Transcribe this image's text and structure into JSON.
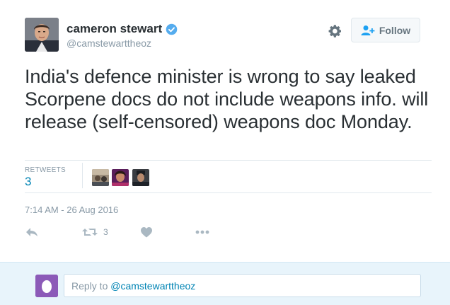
{
  "author": {
    "name": "cameron stewart",
    "handle": "@camstewarttheoz",
    "verified": true
  },
  "follow_button": {
    "label": "Follow"
  },
  "tweet": {
    "text": "India's defence minister is wrong to say leaked Scorpene docs do not include weapons info. will release (self-censored) weapons doc Monday.",
    "timestamp": "7:14 AM - 26 Aug 2016"
  },
  "stats": {
    "retweets_label": "RETWEETS",
    "retweets_count": "3"
  },
  "actions": {
    "reply_icon": "reply-arrow-icon",
    "retweet_icon": "retweet-icon",
    "retweet_count": "3",
    "like_icon": "heart-icon",
    "more_icon": "more-dots-icon"
  },
  "reply_box": {
    "prefix": "Reply to ",
    "mention": "@camstewarttheoz"
  },
  "colors": {
    "link_blue": "#0084b4",
    "verified_blue": "#55acee",
    "muted_gray": "#8899a6",
    "reply_area_bg": "#e8f4fb",
    "me_avatar_purple": "#8c5ab8"
  }
}
